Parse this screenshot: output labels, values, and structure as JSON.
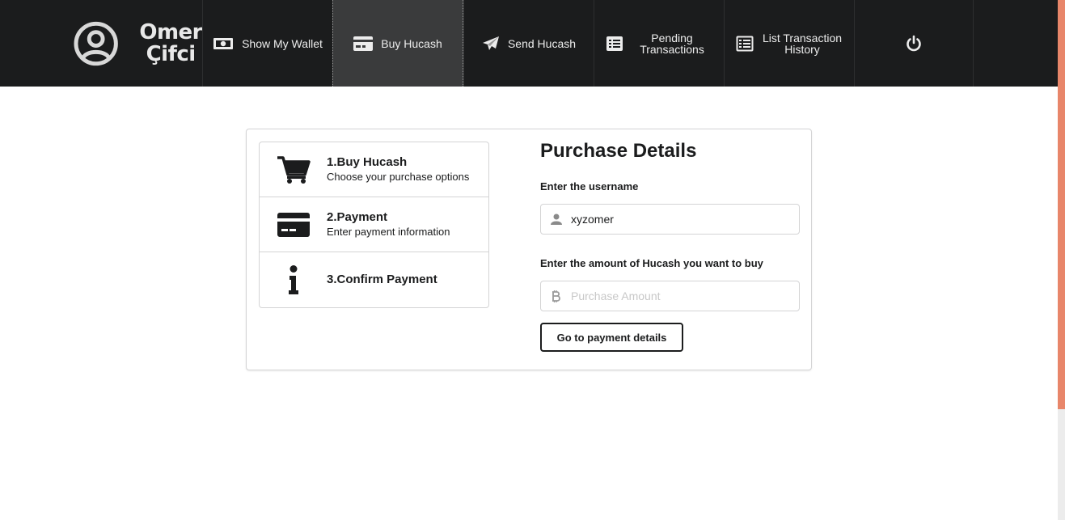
{
  "user": {
    "first_name": "Omer",
    "last_name": "Çifci"
  },
  "nav": {
    "items": [
      {
        "label": "Show My Wallet",
        "icon": "money-bill-icon"
      },
      {
        "label": "Buy Hucash",
        "icon": "credit-card-icon",
        "active": true
      },
      {
        "label": "Send Hucash",
        "icon": "paper-plane-icon"
      },
      {
        "label": "Pending Transactions",
        "icon": "list-icon"
      },
      {
        "label": "List Transaction History",
        "icon": "list-icon"
      }
    ],
    "power_icon": "power-icon"
  },
  "steps": [
    {
      "title": "1.Buy Hucash",
      "description": "Choose your purchase options",
      "icon": "shopping-cart-icon"
    },
    {
      "title": "2.Payment",
      "description": "Enter payment information",
      "icon": "credit-card-icon"
    },
    {
      "title": "3.Confirm Payment",
      "description": "",
      "icon": "info-icon"
    }
  ],
  "form": {
    "title": "Purchase Details",
    "username_label": "Enter the username",
    "username_value": "xyzomer",
    "amount_label": "Enter the amount of Hucash you want to buy",
    "amount_placeholder": "Purchase Amount",
    "amount_value": "",
    "submit_label": "Go to payment details"
  },
  "colors": {
    "navbar": "#1b1c1d",
    "nav_active": "#3a3b3c",
    "scroll_thumb": "#e8866a"
  }
}
